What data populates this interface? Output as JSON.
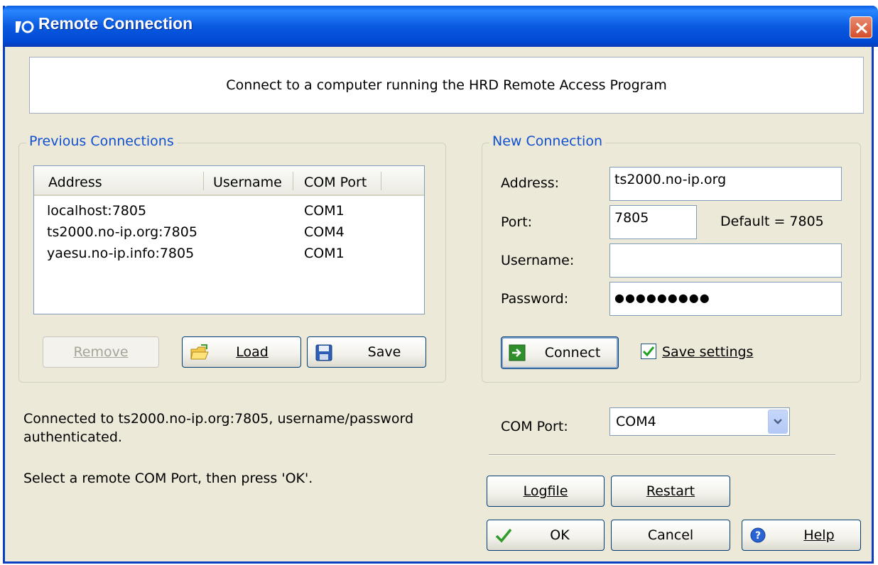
{
  "window": {
    "title": "Remote Connection"
  },
  "banner": {
    "text": "Connect to a computer running the HRD Remote Access Program"
  },
  "previous": {
    "title": "Previous Connections",
    "columns": [
      "Address",
      "Username",
      "COM Port"
    ],
    "rows": [
      {
        "address": "localhost:7805",
        "username": "",
        "com": "COM1"
      },
      {
        "address": "ts2000.no-ip.org:7805",
        "username": "",
        "com": "COM4"
      },
      {
        "address": "yaesu.no-ip.info:7805",
        "username": "",
        "com": "COM1"
      }
    ],
    "remove_label": "Remove",
    "load_label": "Load",
    "save_label": "Save"
  },
  "newconn": {
    "title": "New Connection",
    "address_label": "Address:",
    "address_value": "ts2000.no-ip.org",
    "port_label": "Port:",
    "port_value": "7805",
    "port_default": "Default = 7805",
    "username_label": "Username:",
    "username_value": "",
    "password_label": "Password:",
    "password_value": "●●●●●●●●●",
    "connect_label": "Connect",
    "save_settings_label": "Save settings",
    "save_settings_checked": true
  },
  "status": {
    "line1": "Connected to ts2000.no-ip.org:7805, username/password authenticated.",
    "line2": "Select a remote COM Port, then press 'OK'."
  },
  "comport": {
    "label": "COM Port:",
    "value": "COM4"
  },
  "buttons": {
    "logfile": "Logfile",
    "restart": "Restart",
    "ok": "OK",
    "cancel": "Cancel",
    "help": "Help"
  },
  "colors": {
    "titlebar": "#0a5ae0",
    "group_title": "#1050d0",
    "dialog_bg": "#ece9d8"
  }
}
